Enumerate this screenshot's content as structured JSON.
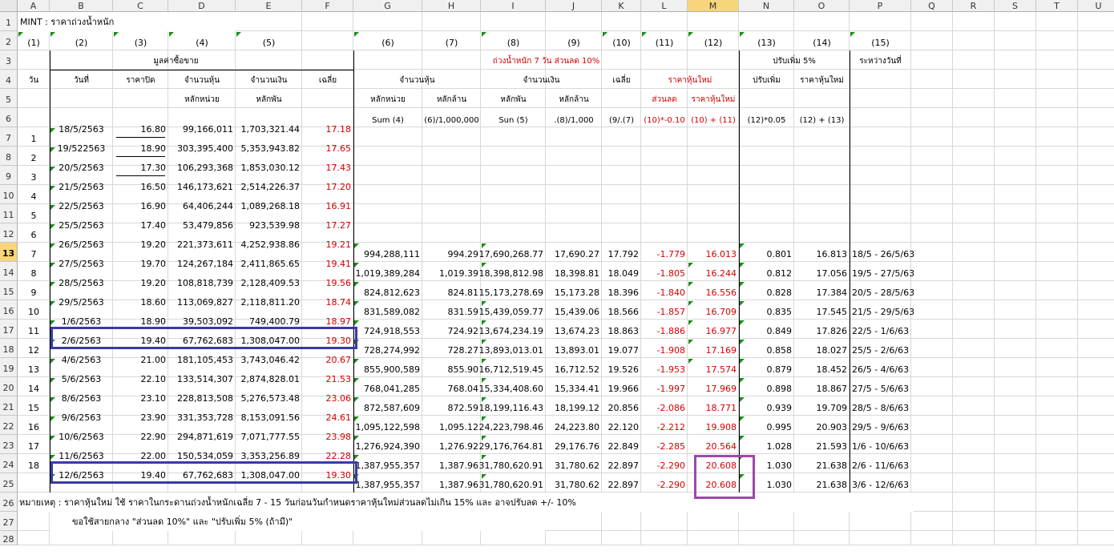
{
  "columns": [
    "A",
    "B",
    "C",
    "D",
    "E",
    "F",
    "G",
    "H",
    "I",
    "J",
    "K",
    "L",
    "M",
    "N",
    "O",
    "P",
    "Q",
    "R",
    "S",
    "T",
    "U"
  ],
  "rows": [
    "1",
    "2",
    "3",
    "4",
    "5",
    "6",
    "7",
    "8",
    "9",
    "10",
    "11",
    "12",
    "13",
    "14",
    "15",
    "16",
    "17",
    "18",
    "19",
    "20",
    "21",
    "22",
    "23",
    "24",
    "25",
    "26",
    "27",
    "28"
  ],
  "title": "MINT : ราคาถ่วงน้ำหนัก",
  "col_numbers": [
    "(1)",
    "(2)",
    "(3)",
    "(4)",
    "(5)",
    "(6)",
    "(7)",
    "(8)",
    "(9)",
    "(10)",
    "(11)",
    "(12)",
    "(13)",
    "(14)",
    "(15)"
  ],
  "headers": {
    "buysell_value": "มูลค่าซื้อขาย",
    "weighted": "ถ่วงน้ำหนัก   7  วัน   ส่วนลด   10%",
    "adjust_up": "ปรับเพิ่ม   5%",
    "between_dates": "ระหว่างวันที่",
    "day": "วัน",
    "date": "วันที่",
    "close": "ราคาปิด",
    "shares": "จำนวนหุ้น",
    "amount": "จำนวนเงิน",
    "avg": "เฉลี่ย",
    "shares2": "จำนวนหุ้น",
    "amount2": "จำนวนเงิน",
    "avg2": "เฉลี่ย",
    "new_price": "ราคาหุ้นใหม่",
    "adjust": "ปรับเพิ่ม",
    "new_price2": "ราคาหุ้นใหม่",
    "unit": "หลักหน่วย",
    "thousand": "หลักพัน",
    "unit2": "หลักหน่วย",
    "million": "หลักล้าน",
    "thousand2": "หลักพัน",
    "million2": "หลักล้าน",
    "discount": "ส่วนลด",
    "new_price3": "ราคาหุ้นใหม่",
    "f_sum4": "Sum (4)",
    "f_div_h": "(6)/1,000,000",
    "f_sum5": "Sun (5)",
    "f_div_j": ".(8)/1,000",
    "f_avg": "(9/.(7)",
    "f_disc": "(10)*-0.10",
    "f_new": "(10) + (11)",
    "f_adj": "(12)*0.05",
    "f_new2": "(12) + (13)"
  },
  "table": [
    {
      "day": "1",
      "date": "18/5/2563",
      "close": "16.80",
      "shares": "99,166,011",
      "amount": "1,703,321.44",
      "avg": "17.18"
    },
    {
      "day": "2",
      "date": "19/522563",
      "close": "18.90",
      "shares": "303,395,400",
      "amount": "5,353,943.82",
      "avg": "17.65"
    },
    {
      "day": "3",
      "date": "20/5/2563",
      "close": "17.30",
      "shares": "106,293,368",
      "amount": "1,853,030.12",
      "avg": "17.43"
    },
    {
      "day": "4",
      "date": "21/5/2563",
      "close": "16.50",
      "shares": "146,173,621",
      "amount": "2,514,226.37",
      "avg": "17.20"
    },
    {
      "day": "5",
      "date": "22/5/2563",
      "close": "16.90",
      "shares": "64,406,244",
      "amount": "1,089,268.18",
      "avg": "16.91"
    },
    {
      "day": "6",
      "date": "25/5/2563",
      "close": "17.40",
      "shares": "53,479,856",
      "amount": "923,539.98",
      "avg": "17.27"
    },
    {
      "day": "7",
      "date": "26/5/2563",
      "close": "19.20",
      "shares": "221,373,611",
      "amount": "4,252,938.86",
      "avg": "19.21",
      "g": "994,288,111",
      "h": "994.29",
      "i": "17,690,268.77",
      "j": "17,690.27",
      "k": "17.792",
      "l": "-1.779",
      "m": "16.013",
      "n": "0.801",
      "o": "16.813",
      "p": "18/5 - 26/5/63"
    },
    {
      "day": "8",
      "date": "27/5/2563",
      "close": "19.70",
      "shares": "124,267,184",
      "amount": "2,411,865.65",
      "avg": "19.41",
      "g": "1,019,389,284",
      "h": "1,019.39",
      "i": "18,398,812.98",
      "j": "18,398.81",
      "k": "18.049",
      "l": "-1.805",
      "m": "16.244",
      "n": "0.812",
      "o": "17.056",
      "p": "19/5 - 27/5/63"
    },
    {
      "day": "9",
      "date": "28/5/2563",
      "close": "19.20",
      "shares": "108,818,739",
      "amount": "2,128,409.53",
      "avg": "19.56",
      "g": "824,812,623",
      "h": "824.81",
      "i": "15,173,278.69",
      "j": "15,173.28",
      "k": "18.396",
      "l": "-1.840",
      "m": "16.556",
      "n": "0.828",
      "o": "17.384",
      "p": "20/5 - 28/5/63"
    },
    {
      "day": "10",
      "date": "29/5/2563",
      "close": "18.60",
      "shares": "113,069,827",
      "amount": "2,118,811.20",
      "avg": "18.74",
      "g": "831,589,082",
      "h": "831.59",
      "i": "15,439,059.77",
      "j": "15,439.06",
      "k": "18.566",
      "l": "-1.857",
      "m": "16.709",
      "n": "0.835",
      "o": "17.545",
      "p": "21/5 - 29/5/63"
    },
    {
      "day": "11",
      "date": "1/6/2563",
      "close": "18.90",
      "shares": "39,503,092",
      "amount": "749,400.79",
      "avg": "18.97",
      "g": "724,918,553",
      "h": "724.92",
      "i": "13,674,234.19",
      "j": "13,674.23",
      "k": "18.863",
      "l": "-1.886",
      "m": "16.977",
      "n": "0.849",
      "o": "17.826",
      "p": "22/5 - 1/6/63"
    },
    {
      "day": "12",
      "date": "2/6/2563",
      "close": "19.40",
      "shares": "67,762,683",
      "amount": "1,308,047.00",
      "avg": "19.30",
      "g": "728,274,992",
      "h": "728.27",
      "i": "13,893,013.01",
      "j": "13,893.01",
      "k": "19.077",
      "l": "-1.908",
      "m": "17.169",
      "n": "0.858",
      "o": "18.027",
      "p": "25/5 - 2/6/63"
    },
    {
      "day": "13",
      "date": "4/6/2563",
      "close": "21.00",
      "shares": "181,105,453",
      "amount": "3,743,046.42",
      "avg": "20.67",
      "g": "855,900,589",
      "h": "855.90",
      "i": "16,712,519.45",
      "j": "16,712.52",
      "k": "19.526",
      "l": "-1.953",
      "m": "17.574",
      "n": "0.879",
      "o": "18.452",
      "p": "26/5 - 4/6/63"
    },
    {
      "day": "14",
      "date": "5/6/2563",
      "close": "22.10",
      "shares": "133,514,307",
      "amount": "2,874,828.01",
      "avg": "21.53",
      "g": "768,041,285",
      "h": "768.04",
      "i": "15,334,408.60",
      "j": "15,334.41",
      "k": "19.966",
      "l": "-1.997",
      "m": "17.969",
      "n": "0.898",
      "o": "18.867",
      "p": "27/5 - 5/6/63"
    },
    {
      "day": "15",
      "date": "8/6/2563",
      "close": "23.10",
      "shares": "228,813,508",
      "amount": "5,276,573.48",
      "avg": "23.06",
      "g": "872,587,609",
      "h": "872.59",
      "i": "18,199,116.43",
      "j": "18,199.12",
      "k": "20.856",
      "l": "-2.086",
      "m": "18.771",
      "n": "0.939",
      "o": "19.709",
      "p": "28/5 - 8/6/63"
    },
    {
      "day": "16",
      "date": "9/6/2563",
      "close": "23.90",
      "shares": "331,353,728",
      "amount": "8,153,091.56",
      "avg": "24.61",
      "g": "1,095,122,598",
      "h": "1,095.12",
      "i": "24,223,798.46",
      "j": "24,223.80",
      "k": "22.120",
      "l": "-2.212",
      "m": "19.908",
      "n": "0.995",
      "o": "20.903",
      "p": "29/5 - 9/6/63"
    },
    {
      "day": "17",
      "date": "10/6/2563",
      "close": "22.90",
      "shares": "294,871,619",
      "amount": "7,071,777.55",
      "avg": "23.98",
      "g": "1,276,924,390",
      "h": "1,276.92",
      "i": "29,176,764.81",
      "j": "29,176.76",
      "k": "22.849",
      "l": "-2.285",
      "m": "20.564",
      "n": "1.028",
      "o": "21.593",
      "p": "1/6 - 10/6/63"
    },
    {
      "day": "18",
      "date": "11/6/2563",
      "close": "22.00",
      "shares": "150,534,059",
      "amount": "3,353,256.89",
      "avg": "22.28",
      "g": "1,387,955,357",
      "h": "1,387.96",
      "i": "31,780,620.91",
      "j": "31,780.62",
      "k": "22.897",
      "l": "-2.290",
      "m": "20.608",
      "n": "1.030",
      "o": "21.638",
      "p": "2/6 - 11/6/63"
    },
    {
      "day": "",
      "date": "12/6/2563",
      "close": "19.40",
      "shares": "67,762,683",
      "amount": "1,308,047.00",
      "avg": "19.30",
      "g": "1,387,955,357",
      "h": "1,387.96",
      "i": "31,780,620.91",
      "j": "31,780.62",
      "k": "22.897",
      "l": "-2.290",
      "m": "20.608",
      "n": "1.030",
      "o": "21.638",
      "p": "3/6 - 12/6/63"
    }
  ],
  "note1": "หมายเหตุ : ราคาหุ้นใหม่ ใช้ ราคาในกระดานถ่วงน้ำหนักเฉลี่ย 7 - 15 วันก่อนวันกำหนดราคาหุ้นใหม่ส่วนลดไม่เกิน 15% และ อาจปรับลด +/- 10%",
  "note2": "ขอใช้สายกลาง \"ส่วนลด 10%\" และ \"ปรับเพิ่ม 5% (ถ้ามี)\"",
  "colors": {
    "red_text": "#d40000",
    "highlight_blue": "#3a3aa8",
    "highlight_purple": "#9a4aa8",
    "selected_header": "#f7d57a"
  }
}
